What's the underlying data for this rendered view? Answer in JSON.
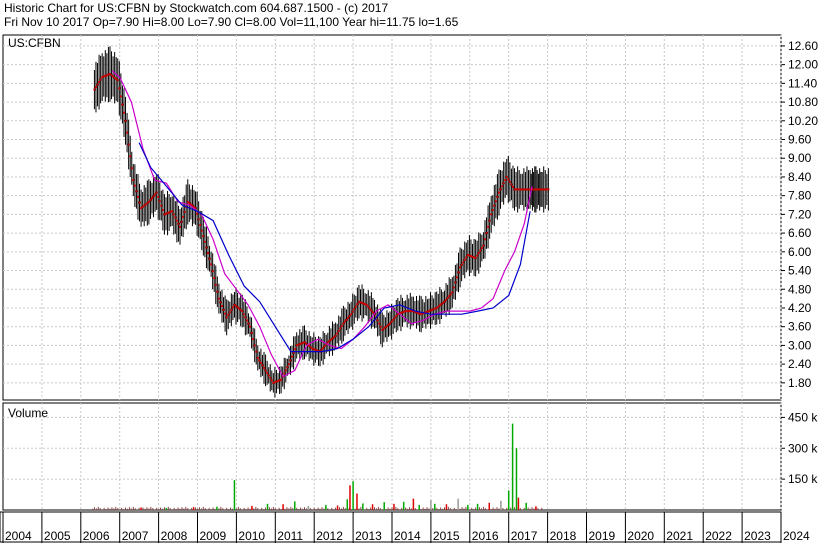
{
  "header": {
    "line1": "Historic Chart for US:CFBN by Stockwatch.com 604.687.1500 - (c) 2017",
    "line2": "Fri Nov 10 2017   Op=7.90   Hi=8.00   Lo=7.90   Cl=8.00   Vol=11,100   Year hi=11.75   lo=1.65"
  },
  "chart_data": [
    {
      "type": "line",
      "panel": "price",
      "label": "US:CFBN",
      "y_ticks": [
        "12.60",
        "12.00",
        "11.40",
        "10.80",
        "10.20",
        "9.60",
        "9.00",
        "8.40",
        "7.80",
        "7.20",
        "6.60",
        "6.00",
        "5.40",
        "4.80",
        "4.20",
        "3.60",
        "3.00",
        "2.40",
        "1.80"
      ],
      "ylim": [
        1.25,
        12.95
      ],
      "x_ticks": [
        "2004",
        "2005",
        "2006",
        "2007",
        "2008",
        "2009",
        "2010",
        "2011",
        "2012",
        "2013",
        "2014",
        "2015",
        "2016",
        "2017",
        "2018",
        "2019",
        "2020",
        "2021",
        "2022",
        "2023",
        "2024"
      ],
      "xlim": [
        2004,
        2024
      ],
      "grid": true,
      "colors": {
        "bars": "#000000",
        "close_marks": "#cc0000",
        "ma_short": "#cc00cc",
        "ma_long": "#0000cc"
      },
      "series": [
        {
          "name": "",
          "style": "close",
          "x": [
            2006.35,
            2006.55,
            2006.75,
            2006.95,
            2007.15,
            2007.35,
            2007.55,
            2007.75,
            2007.95,
            2008.15,
            2008.35,
            2008.55,
            2008.75,
            2008.95,
            2009.15,
            2009.35,
            2009.55,
            2009.75,
            2009.95,
            2010.15,
            2010.35,
            2010.55,
            2010.75,
            2010.95,
            2011.15,
            2011.35,
            2011.55,
            2011.75,
            2011.95,
            2012.15,
            2012.35,
            2012.55,
            2012.75,
            2012.95,
            2013.15,
            2013.35,
            2013.55,
            2013.75,
            2013.95,
            2014.15,
            2014.35,
            2014.55,
            2014.75,
            2014.95,
            2015.15,
            2015.35,
            2015.55,
            2015.75,
            2015.95,
            2016.15,
            2016.35,
            2016.55,
            2016.75,
            2016.95,
            2017.15,
            2017.35,
            2017.55,
            2017.7,
            2017.86
          ],
          "y": [
            11.2,
            11.6,
            11.7,
            11.5,
            10.2,
            8.3,
            7.4,
            7.6,
            7.9,
            7.2,
            7.3,
            6.8,
            7.6,
            7.4,
            6.5,
            5.6,
            4.5,
            3.9,
            4.3,
            4.1,
            3.6,
            2.6,
            2.2,
            1.8,
            1.9,
            2.4,
            3.0,
            3.1,
            2.9,
            2.8,
            3.1,
            3.3,
            3.7,
            4.0,
            4.4,
            4.3,
            4.0,
            3.5,
            3.7,
            4.0,
            4.1,
            4.1,
            4.0,
            4.1,
            4.2,
            4.4,
            4.7,
            5.5,
            5.9,
            5.8,
            6.2,
            7.2,
            7.9,
            8.4,
            8.0,
            8.0,
            8.0,
            8.0,
            8.0
          ]
        },
        {
          "name": "",
          "style": "ma_short",
          "x": [
            2006.8,
            2007.0,
            2007.3,
            2007.6,
            2007.9,
            2008.2,
            2008.5,
            2008.8,
            2009.1,
            2009.4,
            2009.7,
            2010.0,
            2010.3,
            2010.6,
            2010.9,
            2011.2,
            2011.5,
            2011.8,
            2012.1,
            2012.4,
            2012.7,
            2013.0,
            2013.3,
            2013.6,
            2013.9,
            2014.2,
            2014.5,
            2014.8,
            2015.1,
            2015.4,
            2015.7,
            2016.0,
            2016.3,
            2016.6,
            2016.9,
            2017.15,
            2017.4,
            2017.6
          ],
          "y": [
            11.8,
            11.6,
            10.8,
            9.3,
            8.3,
            8.2,
            7.6,
            7.5,
            7.2,
            6.4,
            5.3,
            4.8,
            4.3,
            3.6,
            2.7,
            2.0,
            2.2,
            3.0,
            3.2,
            3.0,
            2.9,
            3.2,
            3.6,
            4.1,
            4.3,
            4.0,
            3.7,
            3.8,
            4.0,
            4.1,
            4.1,
            4.1,
            4.2,
            4.5,
            5.4,
            6.0,
            6.9,
            8.1
          ]
        },
        {
          "name": "",
          "style": "ma_long",
          "x": [
            2007.5,
            2007.8,
            2008.2,
            2008.6,
            2009.0,
            2009.4,
            2009.8,
            2010.2,
            2010.6,
            2011.0,
            2011.4,
            2011.8,
            2012.2,
            2012.6,
            2013.0,
            2013.4,
            2013.8,
            2014.2,
            2014.6,
            2015.0,
            2015.4,
            2015.8,
            2016.2,
            2016.6,
            2017.0,
            2017.3,
            2017.55
          ],
          "y": [
            9.5,
            8.7,
            8.1,
            7.5,
            7.3,
            7.0,
            5.9,
            4.9,
            4.4,
            3.6,
            2.8,
            2.8,
            2.8,
            2.9,
            3.2,
            3.6,
            4.2,
            4.3,
            4.1,
            4.0,
            4.0,
            4.0,
            4.1,
            4.2,
            4.6,
            5.6,
            7.3
          ]
        }
      ]
    },
    {
      "type": "bar",
      "panel": "volume",
      "label": "Volume",
      "y_ticks": [
        "450 k",
        "300 k",
        "150 k"
      ],
      "ylim": [
        0,
        520000
      ],
      "grid": true,
      "colors": {
        "up": "#00aa00",
        "down": "#dd0000",
        "neutral": "#999999"
      },
      "spikes": [
        {
          "x": 2007.55,
          "v": 12000,
          "dir": "down"
        },
        {
          "x": 2008.2,
          "v": 10000,
          "dir": "up"
        },
        {
          "x": 2008.9,
          "v": 14000,
          "dir": "down"
        },
        {
          "x": 2009.5,
          "v": 16000,
          "dir": "up"
        },
        {
          "x": 2009.95,
          "v": 145000,
          "dir": "up"
        },
        {
          "x": 2010.4,
          "v": 20000,
          "dir": "down"
        },
        {
          "x": 2010.8,
          "v": 30000,
          "dir": "up"
        },
        {
          "x": 2011.2,
          "v": 28000,
          "dir": "down"
        },
        {
          "x": 2011.5,
          "v": 42000,
          "dir": "up"
        },
        {
          "x": 2011.85,
          "v": 20000,
          "dir": "neutral"
        },
        {
          "x": 2012.3,
          "v": 25000,
          "dir": "up"
        },
        {
          "x": 2012.6,
          "v": 22000,
          "dir": "down"
        },
        {
          "x": 2012.85,
          "v": 52000,
          "dir": "up"
        },
        {
          "x": 2012.92,
          "v": 120000,
          "dir": "down"
        },
        {
          "x": 2013.0,
          "v": 140000,
          "dir": "up"
        },
        {
          "x": 2013.1,
          "v": 80000,
          "dir": "down"
        },
        {
          "x": 2013.25,
          "v": 32000,
          "dir": "up"
        },
        {
          "x": 2013.5,
          "v": 28000,
          "dir": "down"
        },
        {
          "x": 2013.8,
          "v": 38000,
          "dir": "up"
        },
        {
          "x": 2014.05,
          "v": 30000,
          "dir": "down"
        },
        {
          "x": 2014.3,
          "v": 40000,
          "dir": "up"
        },
        {
          "x": 2014.55,
          "v": 55000,
          "dir": "down"
        },
        {
          "x": 2014.7,
          "v": 25000,
          "dir": "up"
        },
        {
          "x": 2015.0,
          "v": 48000,
          "dir": "neutral"
        },
        {
          "x": 2015.1,
          "v": 30000,
          "dir": "up"
        },
        {
          "x": 2015.4,
          "v": 28000,
          "dir": "down"
        },
        {
          "x": 2015.7,
          "v": 55000,
          "dir": "neutral"
        },
        {
          "x": 2015.95,
          "v": 25000,
          "dir": "up"
        },
        {
          "x": 2016.2,
          "v": 30000,
          "dir": "up"
        },
        {
          "x": 2016.5,
          "v": 35000,
          "dir": "down"
        },
        {
          "x": 2016.8,
          "v": 45000,
          "dir": "neutral"
        },
        {
          "x": 2017.0,
          "v": 95000,
          "dir": "up"
        },
        {
          "x": 2017.1,
          "v": 420000,
          "dir": "up"
        },
        {
          "x": 2017.2,
          "v": 300000,
          "dir": "up"
        },
        {
          "x": 2017.25,
          "v": 60000,
          "dir": "down"
        },
        {
          "x": 2017.45,
          "v": 35000,
          "dir": "up"
        },
        {
          "x": 2017.7,
          "v": 18000,
          "dir": "down"
        }
      ]
    }
  ]
}
